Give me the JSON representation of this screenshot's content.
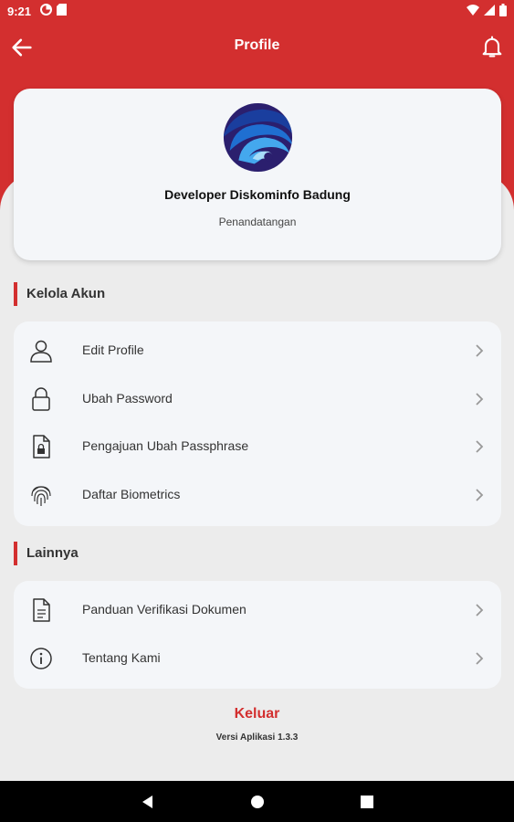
{
  "status_bar": {
    "time": "9:21",
    "left_icons": [
      "data-saver-icon",
      "sim-card-icon"
    ],
    "right_icons": [
      "wifi-icon",
      "signal-icon",
      "battery-icon"
    ]
  },
  "header": {
    "title": "Profile",
    "back_icon": "arrow-left-icon",
    "notification_icon": "bell-icon"
  },
  "profile": {
    "name": "Developer Diskominfo Badung",
    "role": "Penandatangan"
  },
  "sections": {
    "account": {
      "title": "Kelola Akun",
      "items": [
        {
          "label": "Edit Profile",
          "icon": "user-icon"
        },
        {
          "label": "Ubah Password",
          "icon": "lock-icon"
        },
        {
          "label": "Pengajuan Ubah Passphrase",
          "icon": "locked-file-icon"
        },
        {
          "label": "Daftar Biometrics",
          "icon": "fingerprint-icon"
        }
      ]
    },
    "other": {
      "title": "Lainnya",
      "items": [
        {
          "label": "Panduan Verifikasi Dokumen",
          "icon": "document-icon"
        },
        {
          "label": "Tentang Kami",
          "icon": "info-icon"
        }
      ]
    }
  },
  "footer": {
    "logout_label": "Keluar",
    "version": "Versi Aplikasi 1.3.3"
  },
  "colors": {
    "primary": "#d32f2f",
    "background": "#ececec",
    "card": "#f4f6f9"
  }
}
